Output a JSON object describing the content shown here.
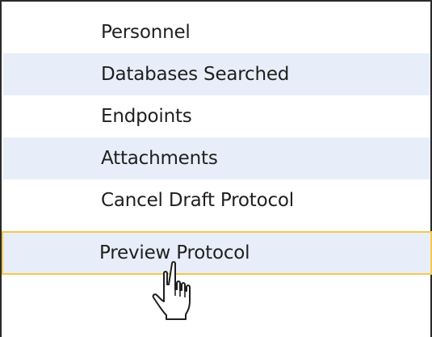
{
  "menu": {
    "items": [
      {
        "label": "Personnel"
      },
      {
        "label": "Databases Searched"
      },
      {
        "label": "Endpoints"
      },
      {
        "label": "Attachments"
      },
      {
        "label": "Cancel Draft Protocol"
      },
      {
        "label": "Preview Protocol"
      }
    ]
  },
  "colors": {
    "alt_row_background": "#e8eef9",
    "hover_border": "#f2c94c",
    "panel_border": "#2a2a2a"
  },
  "cursor": {
    "icon": "hand-pointer-icon"
  }
}
